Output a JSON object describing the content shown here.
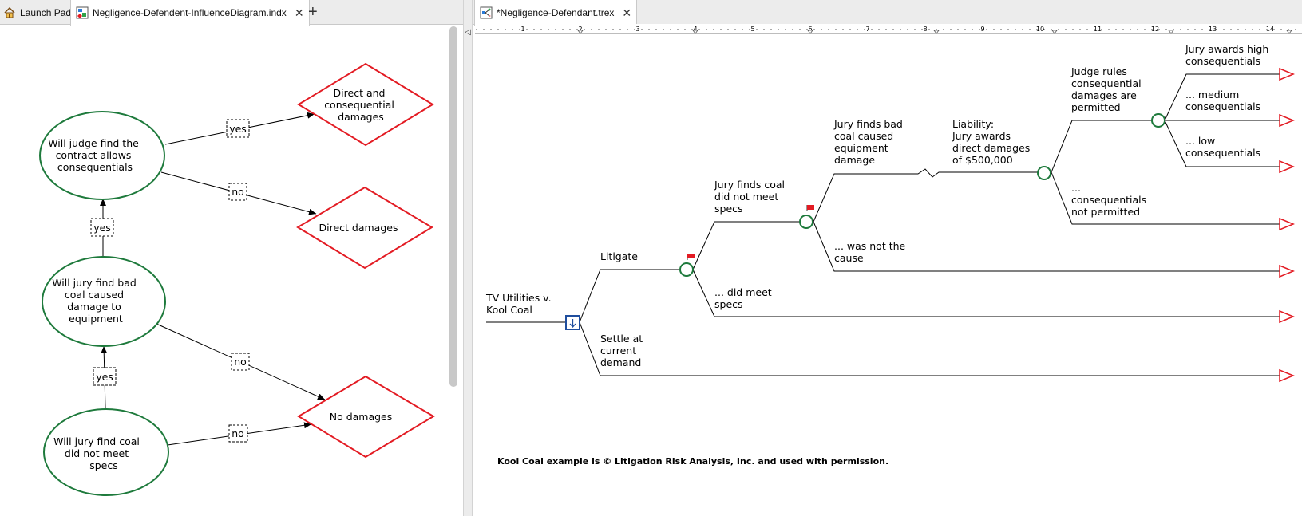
{
  "tabs_left": {
    "launch_pad": "Launch Pad",
    "influence_diagram": "Negligence-Defendent-InfluenceDiagram.indx",
    "new_tab": "+"
  },
  "tabs_right": {
    "tree_file": "*Negligence-Defendant.trex"
  },
  "ruler": {
    "numbers": [
      "1",
      "2",
      "3",
      "4",
      "5",
      "6",
      "7",
      "8",
      "9",
      "10",
      "11",
      "12",
      "13",
      "14"
    ]
  },
  "influence_diagram": {
    "chance_nodes": [
      {
        "lines": [
          "Will judge find the",
          "contract allows",
          "consequentials"
        ]
      },
      {
        "lines": [
          "Will jury find bad",
          "coal caused",
          "damage to",
          "equipment"
        ]
      },
      {
        "lines": [
          "Will jury find coal",
          "did not meet",
          "specs"
        ]
      }
    ],
    "outcome_nodes": [
      {
        "lines": [
          "Direct and",
          "consequential",
          "damages"
        ]
      },
      {
        "lines": [
          "Direct damages"
        ]
      },
      {
        "lines": [
          "No damages"
        ]
      }
    ],
    "arc_labels": [
      "yes",
      "no",
      "yes",
      "no",
      "yes",
      "no"
    ]
  },
  "decision_tree": {
    "root": [
      "TV Utilities v.",
      "Kool Coal"
    ],
    "branches": {
      "litigate": [
        "Litigate"
      ],
      "settle": [
        "Settle at",
        "current",
        "demand"
      ],
      "did_not_meet": [
        "Jury finds coal",
        "did not meet",
        "specs"
      ],
      "did_meet": [
        "... did meet",
        "specs"
      ],
      "caused": [
        "Jury finds bad",
        "coal caused",
        "equipment",
        "damage"
      ],
      "not_cause": [
        "... was not the",
        "cause"
      ],
      "liability": [
        "Liability:",
        "Jury awards",
        "direct damages",
        "of $500,000"
      ],
      "permitted": [
        "Judge rules",
        "consequential",
        "damages are",
        "permitted"
      ],
      "not_permitted": [
        "...",
        "consequentials",
        "not permitted"
      ],
      "high": [
        "Jury awards high",
        "consequentials"
      ],
      "medium": [
        "... medium",
        "consequentials"
      ],
      "low": [
        "... low",
        "consequentials"
      ]
    },
    "footer": "Kool Coal example is © Litigation Risk Analysis, Inc. and used with permission."
  },
  "colors": {
    "chance_node": "#1e7a3c",
    "outcome_node": "#e31b23",
    "decision_node": "#1f4e9e",
    "terminal": "#e31b23",
    "flag": "#e31b23"
  }
}
